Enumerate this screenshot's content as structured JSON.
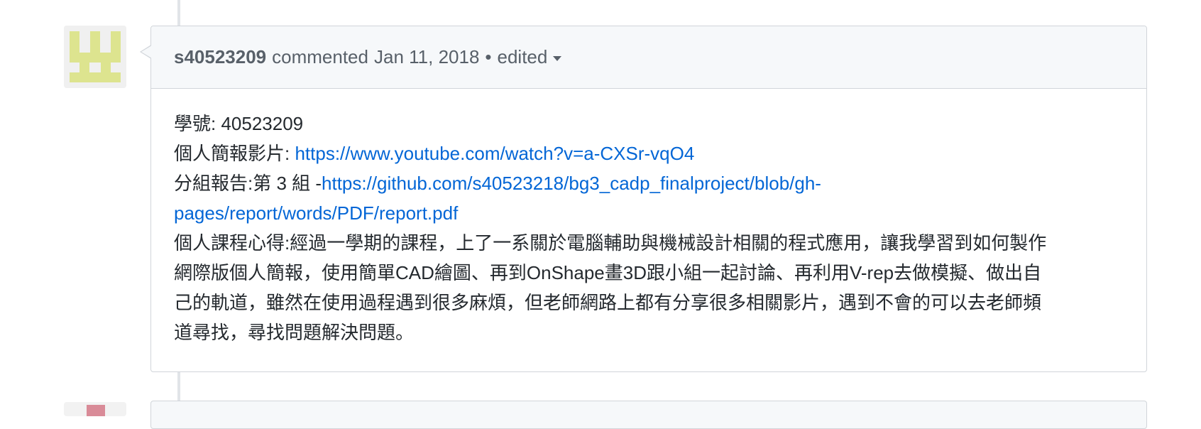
{
  "comment": {
    "author": "s40523209",
    "action": "commented",
    "timestamp": "Jan 11, 2018",
    "bullet": "•",
    "edited_label": "edited",
    "body": {
      "line1_label": "學號: ",
      "line1_value": "40523209",
      "line2_label": "個人簡報影片: ",
      "line2_link": "https://www.youtube.com/watch?v=a-CXSr-vqO4",
      "line3_label": "分組報告:第 3 組 -",
      "line3_link_part1": "https://github.com/s40523218/bg3_cadp_finalproject/blob/gh-",
      "line3_link_part2": "pages/report/words/PDF/report.pdf",
      "reflection_line1": "個人課程心得:經過一學期的課程，上了一系關於電腦輔助與機械設計相關的程式應用，讓我學習到如何製作",
      "reflection_line2": "網際版個人簡報，使用簡單CAD繪圖、再到OnShape畫3D跟小組一起討論、再利用V-rep去做模擬、做出自",
      "reflection_line3": "己的軌道，雖然在使用過程遇到很多麻煩，但老師網路上都有分享很多相關影片，遇到不會的可以去老師頻",
      "reflection_line4": "道尋找，尋找問題解決問題。"
    }
  },
  "colors": {
    "link": "#0366d6",
    "header_bg": "#f6f8fa",
    "border": "#d1d5da",
    "avatar_identicon": "#dde48f",
    "next_avatar_identicon": "#d98b98"
  },
  "icons": {
    "edited_caret": "chevron-down-icon"
  }
}
